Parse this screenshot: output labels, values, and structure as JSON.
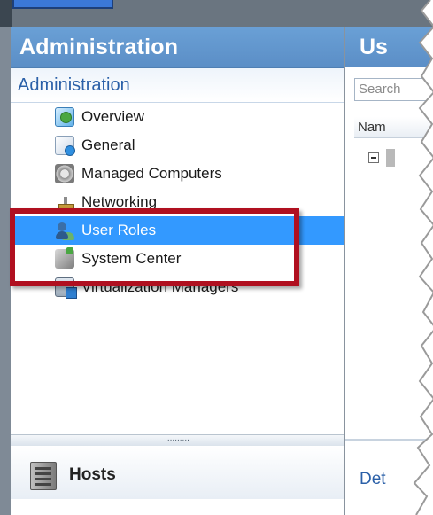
{
  "left_panel": {
    "header_title": "Administration",
    "section_title": "Administration",
    "items": [
      {
        "label": "Overview",
        "icon": "overview-icon",
        "selected": false
      },
      {
        "label": "General",
        "icon": "general-settings-icon",
        "selected": false
      },
      {
        "label": "Managed Computers",
        "icon": "managed-computers-icon",
        "selected": false
      },
      {
        "label": "Networking",
        "icon": "networking-icon",
        "selected": false
      },
      {
        "label": "User Roles",
        "icon": "user-roles-icon",
        "selected": true
      },
      {
        "label": "System Center",
        "icon": "system-center-icon",
        "selected": false
      },
      {
        "label": "Virtualization Managers",
        "icon": "virtualization-managers-icon",
        "selected": false
      }
    ],
    "splitter_dots": "..........",
    "bottom_nav": {
      "label": "Hosts",
      "icon": "hosts-icon"
    }
  },
  "right_panel": {
    "header_title": "Us",
    "search_placeholder": "Search",
    "column_header": "Nam",
    "details_label": "Det"
  },
  "colors": {
    "header_blue": "#5b8ec6",
    "selection_blue": "#3399ff",
    "section_text": "#2b60a8",
    "highlight_red": "#b01020"
  }
}
